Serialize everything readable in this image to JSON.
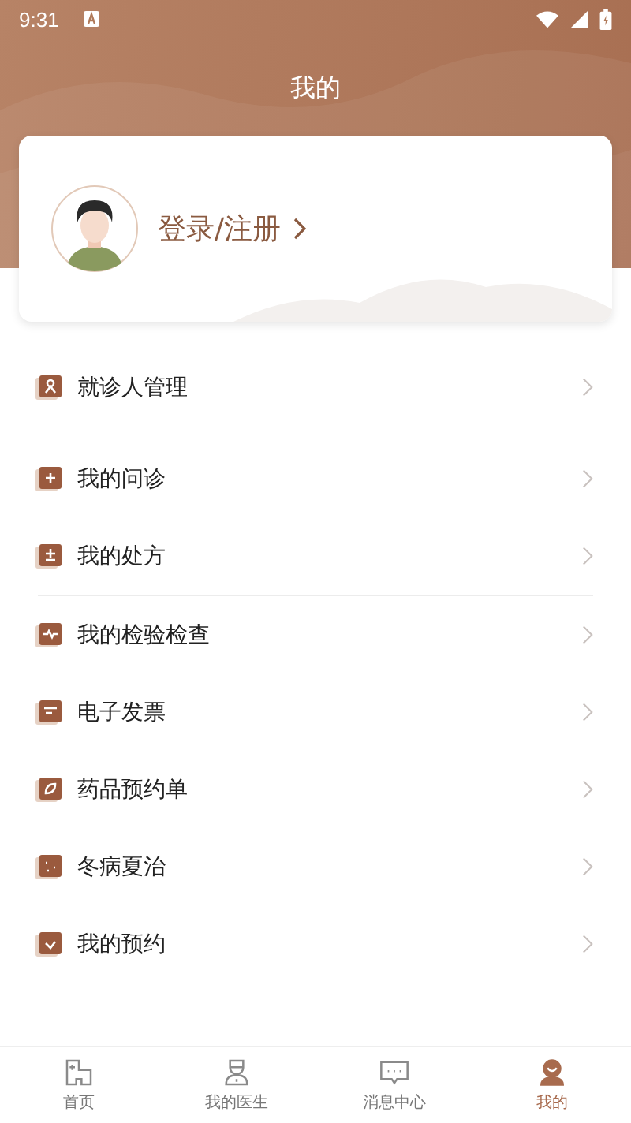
{
  "status_bar": {
    "time": "9:31"
  },
  "header": {
    "title": "我的"
  },
  "profile": {
    "login_label": "登录/注册"
  },
  "menu_groups": [
    {
      "divided": false,
      "items": [
        {
          "label": "就诊人管理"
        }
      ]
    },
    {
      "divided": false,
      "items": [
        {
          "label": "我的问诊"
        },
        {
          "label": "我的处方"
        }
      ]
    },
    {
      "divided": true,
      "items": [
        {
          "label": "我的检验检查"
        },
        {
          "label": "电子发票"
        },
        {
          "label": "药品预约单"
        },
        {
          "label": "冬病夏治"
        },
        {
          "label": "我的预约"
        }
      ]
    }
  ],
  "tab_bar": [
    {
      "label": "首页",
      "selected": false
    },
    {
      "label": "我的医生",
      "selected": false
    },
    {
      "label": "消息中心",
      "selected": false
    },
    {
      "label": "我的",
      "selected": true
    }
  ]
}
